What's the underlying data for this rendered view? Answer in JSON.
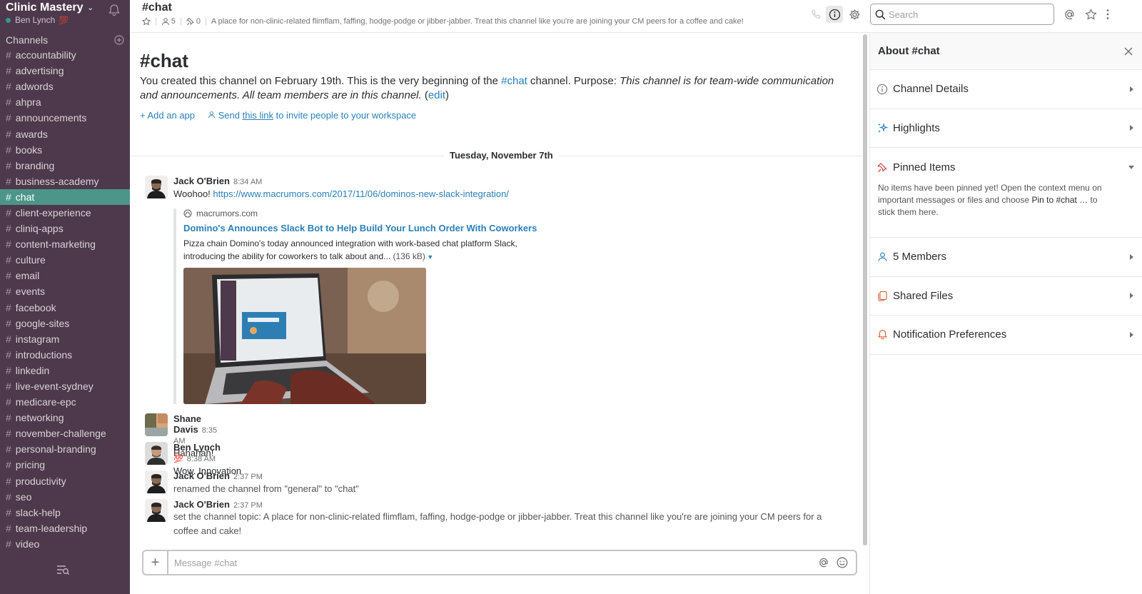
{
  "team": {
    "name": "Clinic Mastery",
    "user": "Ben Lynch"
  },
  "sidebar": {
    "channels_label": "Channels",
    "channels": [
      "accountability",
      "advertising",
      "adwords",
      "ahpra",
      "announcements",
      "awards",
      "books",
      "branding",
      "business-academy",
      "chat",
      "client-experience",
      "cliniq-apps",
      "content-marketing",
      "culture",
      "email",
      "events",
      "facebook",
      "google-sites",
      "instagram",
      "introductions",
      "linkedin",
      "live-event-sydney",
      "medicare-epc",
      "networking",
      "november-challenge",
      "personal-branding",
      "pricing",
      "productivity",
      "seo",
      "slack-help",
      "team-leadership",
      "video"
    ],
    "active_channel": "chat"
  },
  "header": {
    "channel": "#chat",
    "members": "5",
    "pins": "0",
    "topic": "A place for non-clinic-related flimflam, faffing, hodge-podge or jibber-jabber. Treat this channel like you're are joining your CM peers for a coffee and cake!",
    "search_placeholder": "Search"
  },
  "intro": {
    "title": "#chat",
    "line1": "You created this channel on February 19th. This is the very beginning of the ",
    "channel_link": "#chat",
    "line2": " channel. Purpose: ",
    "purpose": "This channel is for team-wide communication and announcements. All team members are in this channel.",
    "edit": "edit",
    "add_app": "Add an app",
    "invite_prefix": "Send ",
    "invite_link": "this link",
    "invite_suffix": " to invite people to your workspace"
  },
  "day_divider": "Tuesday, November 7th",
  "messages": [
    {
      "author": "Jack O'Brien",
      "time": "8:34 AM",
      "text": "Woohoo! ",
      "link": "https://www.macrumors.com/2017/11/06/dominos-new-slack-integration/"
    },
    {
      "author": "Shane Davis",
      "time": "8:35 AM",
      "text": "Hahahah!"
    },
    {
      "author": "Ben Lynch",
      "time": "8:38 AM",
      "text": "Wow. Innovation"
    },
    {
      "author": "Jack O'Brien",
      "time": "2:37 PM",
      "text": "renamed the channel from \"general\" to \"chat\""
    },
    {
      "author": "Jack O'Brien",
      "time": "2:37 PM",
      "text": "set the channel topic: A place for non-clinic-related flimflam, faffing, hodge-podge or jibber-jabber. Treat this channel like you're are joining your CM peers for a coffee and cake!"
    }
  ],
  "attachment": {
    "site": "macrumors.com",
    "title": "Domino's Announces Slack Bot to Help Build Your Lunch Order With Coworkers",
    "desc": "Pizza chain Domino's today announced integration with work-based chat platform Slack, introducing the ability for coworkers to talk about and... ",
    "size": "(136 kB)"
  },
  "composer": {
    "placeholder": "Message #chat"
  },
  "panel": {
    "title": "About #chat",
    "sections": {
      "details": "Channel Details",
      "highlights": "Highlights",
      "pinned": "Pinned Items",
      "pinned_empty_1": "No items have been pinned yet! Open the context menu on important messages or files and choose ",
      "pinned_empty_strong": "Pin to #chat …",
      "pinned_empty_2": " to stick them here.",
      "members": "5 Members",
      "files": "Shared Files",
      "notifications": "Notification Preferences"
    }
  },
  "colors": {
    "sidebar": "#4d394b",
    "active_channel": "#4c9689",
    "link": "#2a80b9"
  }
}
